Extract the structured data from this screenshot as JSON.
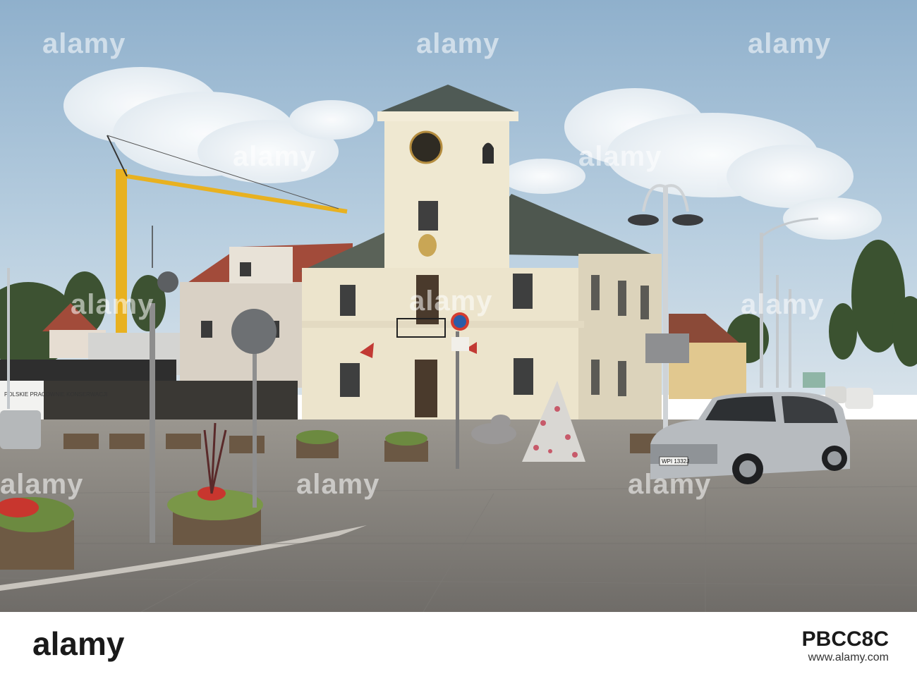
{
  "watermark": {
    "text": "alamy"
  },
  "footer": {
    "logo": "alamy",
    "domain": "www.alamy.com",
    "image_id": "PBCC8C"
  },
  "scene": {
    "license_plate": "WPI 1332J",
    "banner_text": "POLSKIE PRACOWNIE KONSERWACJI",
    "colors": {
      "sky": "#a9c3d9",
      "building": "#ece4cc",
      "roof": "#5a6258",
      "pavement": "#8d8a85",
      "car": "#b9bdc0",
      "crane": "#e8b120"
    }
  }
}
